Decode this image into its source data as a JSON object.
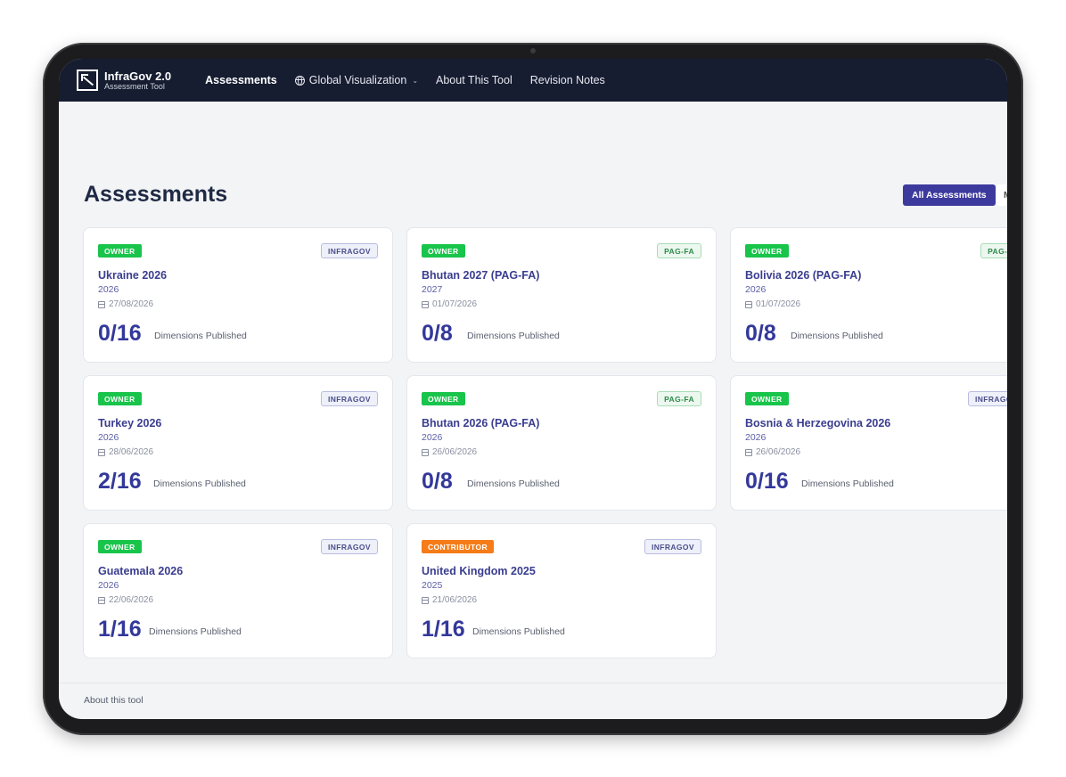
{
  "app": {
    "title": "InfraGov 2.0",
    "subtitle": "Assessment Tool"
  },
  "nav": {
    "assessments": "Assessments",
    "global_viz": "Global Visualization",
    "about": "About This Tool",
    "revision": "Revision Notes"
  },
  "page": {
    "title": "Assessments",
    "filter_active": "All Assessments",
    "filter_next": "M"
  },
  "cards": [
    {
      "role": "OWNER",
      "program": "INFRAGOV",
      "title": "Ukraine 2026",
      "year": "2026",
      "date": "27/08/2026",
      "count": "0/16",
      "count_label": "Dimensions Published"
    },
    {
      "role": "OWNER",
      "program": "PAG-FA",
      "title": "Bhutan 2027 (PAG-FA)",
      "year": "2027",
      "date": "01/07/2026",
      "count": "0/8",
      "count_label": "Dimensions Published"
    },
    {
      "role": "OWNER",
      "program": "PAG-FA",
      "title": "Bolivia 2026 (PAG-FA)",
      "year": "2026",
      "date": "01/07/2026",
      "count": "0/8",
      "count_label": "Dimensions Published"
    },
    {
      "role": "OWNER",
      "program": "INFRAGOV",
      "title": "Turkey 2026",
      "year": "2026",
      "date": "28/06/2026",
      "count": "2/16",
      "count_label": "Dimensions Published"
    },
    {
      "role": "OWNER",
      "program": "PAG-FA",
      "title": "Bhutan 2026 (PAG-FA)",
      "year": "2026",
      "date": "26/06/2026",
      "count": "0/8",
      "count_label": "Dimensions Published"
    },
    {
      "role": "OWNER",
      "program": "INFRAGOV",
      "title": "Bosnia & Herzegovina 2026",
      "year": "2026",
      "date": "26/06/2026",
      "count": "0/16",
      "count_label": "Dimensions Published"
    },
    {
      "role": "OWNER",
      "program": "INFRAGOV",
      "title": "Guatemala 2026",
      "year": "2026",
      "date": "22/06/2026",
      "count": "1/16",
      "count_label": "Dimensions Published"
    },
    {
      "role": "CONTRIBUTOR",
      "program": "INFRAGOV",
      "title": "United Kingdom 2025",
      "year": "2025",
      "date": "21/06/2026",
      "count": "1/16",
      "count_label": "Dimensions Published"
    }
  ],
  "footer": {
    "about_link": "About this tool"
  }
}
